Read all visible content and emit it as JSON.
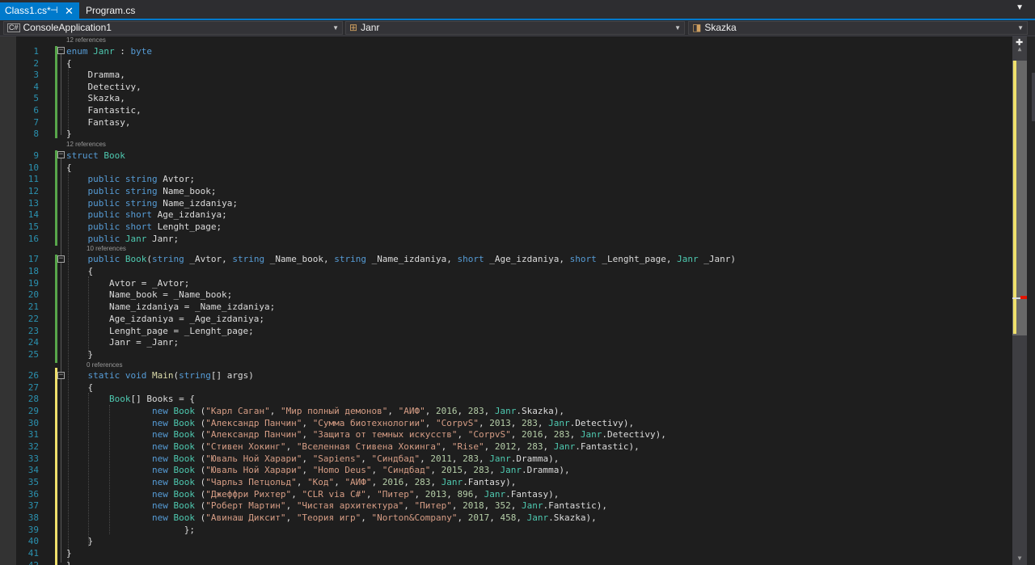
{
  "tabs": [
    {
      "label": "Class1.cs*",
      "pin": "⊣",
      "close": "✕"
    },
    {
      "label": "Program.cs"
    }
  ],
  "tab_dropdown": "▼",
  "navbar": {
    "project": "ConsoleApplication1",
    "project_icon": "C#",
    "type": "Janr",
    "member": "Skazka",
    "dropdown_arrow": "▼",
    "split": "✚"
  },
  "lens": [
    "12 references",
    "12 references",
    "10 references",
    "0 references"
  ],
  "code": [
    {
      "ln": "1",
      "tokens": [
        [
          "k",
          "enum"
        ],
        [
          "",
          ""
        ],
        [
          "t",
          " Janr"
        ],
        [
          "",
          " : "
        ],
        [
          "k",
          "byte"
        ]
      ]
    },
    {
      "ln": "2",
      "tokens": [
        [
          "",
          "{"
        ]
      ]
    },
    {
      "ln": "3",
      "tokens": [
        [
          "",
          "    Dramma,"
        ]
      ]
    },
    {
      "ln": "4",
      "tokens": [
        [
          "",
          "    Detectivy,"
        ]
      ]
    },
    {
      "ln": "5",
      "tokens": [
        [
          "",
          "    Skazka,"
        ]
      ]
    },
    {
      "ln": "6",
      "tokens": [
        [
          "",
          "    Fantastic,"
        ]
      ]
    },
    {
      "ln": "7",
      "tokens": [
        [
          "",
          "    Fantasy,"
        ]
      ]
    },
    {
      "ln": "8",
      "tokens": [
        [
          "",
          "}"
        ]
      ]
    },
    {
      "ln": "9",
      "tokens": [
        [
          "k",
          "struct"
        ],
        [
          "t",
          " Book"
        ]
      ]
    },
    {
      "ln": "10",
      "tokens": [
        [
          "",
          "{"
        ]
      ]
    },
    {
      "ln": "11",
      "tokens": [
        [
          "",
          "    "
        ],
        [
          "k",
          "public"
        ],
        [
          "",
          " "
        ],
        [
          "k",
          "string"
        ],
        [
          "",
          " Avtor;"
        ]
      ]
    },
    {
      "ln": "12",
      "tokens": [
        [
          "",
          "    "
        ],
        [
          "k",
          "public"
        ],
        [
          "",
          " "
        ],
        [
          "k",
          "string"
        ],
        [
          "",
          " Name_book;"
        ]
      ]
    },
    {
      "ln": "13",
      "tokens": [
        [
          "",
          "    "
        ],
        [
          "k",
          "public"
        ],
        [
          "",
          " "
        ],
        [
          "k",
          "string"
        ],
        [
          "",
          " Name_izdaniya;"
        ]
      ]
    },
    {
      "ln": "14",
      "tokens": [
        [
          "",
          "    "
        ],
        [
          "k",
          "public"
        ],
        [
          "",
          " "
        ],
        [
          "k",
          "short"
        ],
        [
          "",
          " Age_izdaniya;"
        ]
      ]
    },
    {
      "ln": "15",
      "tokens": [
        [
          "",
          "    "
        ],
        [
          "k",
          "public"
        ],
        [
          "",
          " "
        ],
        [
          "k",
          "short"
        ],
        [
          "",
          " Lenght_page;"
        ]
      ]
    },
    {
      "ln": "16",
      "tokens": [
        [
          "",
          "    "
        ],
        [
          "k",
          "public"
        ],
        [
          "",
          " "
        ],
        [
          "t",
          "Janr"
        ],
        [
          "",
          " Janr;"
        ]
      ]
    },
    {
      "ln": "17",
      "tokens": [
        [
          "",
          "    "
        ],
        [
          "k",
          "public"
        ],
        [
          "",
          " "
        ],
        [
          "t",
          "Book"
        ],
        [
          "",
          "("
        ],
        [
          "k",
          "string"
        ],
        [
          "",
          " _Avtor, "
        ],
        [
          "k",
          "string"
        ],
        [
          "",
          " _Name_book, "
        ],
        [
          "k",
          "string"
        ],
        [
          "",
          " _Name_izdaniya, "
        ],
        [
          "k",
          "short"
        ],
        [
          "",
          " _Age_izdaniya, "
        ],
        [
          "k",
          "short"
        ],
        [
          "",
          " _Lenght_page, "
        ],
        [
          "t",
          "Janr"
        ],
        [
          "",
          " _Janr)"
        ]
      ]
    },
    {
      "ln": "18",
      "tokens": [
        [
          "",
          "    {"
        ]
      ]
    },
    {
      "ln": "19",
      "tokens": [
        [
          "",
          "        Avtor = _Avtor;"
        ]
      ]
    },
    {
      "ln": "20",
      "tokens": [
        [
          "",
          "        Name_book = _Name_book;"
        ]
      ]
    },
    {
      "ln": "21",
      "tokens": [
        [
          "",
          "        Name_izdaniya = _Name_izdaniya;"
        ]
      ]
    },
    {
      "ln": "22",
      "tokens": [
        [
          "",
          "        Age_izdaniya = _Age_izdaniya;"
        ]
      ]
    },
    {
      "ln": "23",
      "tokens": [
        [
          "",
          "        Lenght_page = _Lenght_page;"
        ]
      ]
    },
    {
      "ln": "24",
      "tokens": [
        [
          "",
          "        Janr = _Janr;"
        ]
      ]
    },
    {
      "ln": "25",
      "tokens": [
        [
          "",
          "    }"
        ]
      ]
    },
    {
      "ln": "26",
      "tokens": [
        [
          "",
          "    "
        ],
        [
          "k",
          "static"
        ],
        [
          "",
          " "
        ],
        [
          "k",
          "void"
        ],
        [
          "",
          " "
        ],
        [
          "m",
          "Main"
        ],
        [
          "",
          "("
        ],
        [
          "k",
          "string"
        ],
        [
          "",
          "[] args)"
        ]
      ]
    },
    {
      "ln": "27",
      "tokens": [
        [
          "",
          "    {"
        ]
      ]
    },
    {
      "ln": "28",
      "tokens": [
        [
          "",
          "        "
        ],
        [
          "t",
          "Book"
        ],
        [
          "",
          "[] Books = {"
        ]
      ]
    },
    {
      "ln": "29",
      "tokens": [
        [
          "",
          "                "
        ],
        [
          "k",
          "new"
        ],
        [
          "",
          " "
        ],
        [
          "t",
          "Book"
        ],
        [
          "",
          " ("
        ],
        [
          "s",
          "\"Карл Саган\""
        ],
        [
          "",
          ", "
        ],
        [
          "s",
          "\"Мир полный демонов\""
        ],
        [
          "",
          ", "
        ],
        [
          "s",
          "\"АИФ\""
        ],
        [
          "",
          ", "
        ],
        [
          "n",
          "2016"
        ],
        [
          "",
          ", "
        ],
        [
          "n",
          "283"
        ],
        [
          "",
          ", "
        ],
        [
          "t",
          "Janr"
        ],
        [
          "",
          ".Skazka),"
        ]
      ]
    },
    {
      "ln": "30",
      "tokens": [
        [
          "",
          "                "
        ],
        [
          "k",
          "new"
        ],
        [
          "",
          " "
        ],
        [
          "t",
          "Book"
        ],
        [
          "",
          " ("
        ],
        [
          "s",
          "\"Александр Панчин\""
        ],
        [
          "",
          ", "
        ],
        [
          "s",
          "\"Сумма биотехнологии\""
        ],
        [
          "",
          ", "
        ],
        [
          "s",
          "\"CorpvS\""
        ],
        [
          "",
          ", "
        ],
        [
          "n",
          "2013"
        ],
        [
          "",
          ", "
        ],
        [
          "n",
          "283"
        ],
        [
          "",
          ", "
        ],
        [
          "t",
          "Janr"
        ],
        [
          "",
          ".Detectivy),"
        ]
      ]
    },
    {
      "ln": "31",
      "tokens": [
        [
          "",
          "                "
        ],
        [
          "k",
          "new"
        ],
        [
          "",
          " "
        ],
        [
          "t",
          "Book"
        ],
        [
          "",
          " ("
        ],
        [
          "s",
          "\"Александр Панчин\""
        ],
        [
          "",
          ", "
        ],
        [
          "s",
          "\"Защита от темных искусств\""
        ],
        [
          "",
          ", "
        ],
        [
          "s",
          "\"CorpvS\""
        ],
        [
          "",
          ", "
        ],
        [
          "n",
          "2016"
        ],
        [
          "",
          ", "
        ],
        [
          "n",
          "283"
        ],
        [
          "",
          ", "
        ],
        [
          "t",
          "Janr"
        ],
        [
          "",
          ".Detectivy),"
        ]
      ]
    },
    {
      "ln": "32",
      "tokens": [
        [
          "",
          "                "
        ],
        [
          "k",
          "new"
        ],
        [
          "",
          " "
        ],
        [
          "t",
          "Book"
        ],
        [
          "",
          " ("
        ],
        [
          "s",
          "\"Стивен Хокинг\""
        ],
        [
          "",
          ", "
        ],
        [
          "s",
          "\"Вселенная Стивена Хокинга\""
        ],
        [
          "",
          ", "
        ],
        [
          "s",
          "\"Rise\""
        ],
        [
          "",
          ", "
        ],
        [
          "n",
          "2012"
        ],
        [
          "",
          ", "
        ],
        [
          "n",
          "283"
        ],
        [
          "",
          ", "
        ],
        [
          "t",
          "Janr"
        ],
        [
          "",
          ".Fantastic),"
        ]
      ]
    },
    {
      "ln": "33",
      "tokens": [
        [
          "",
          "                "
        ],
        [
          "k",
          "new"
        ],
        [
          "",
          " "
        ],
        [
          "t",
          "Book"
        ],
        [
          "",
          " ("
        ],
        [
          "s",
          "\"Юваль Ной Харари\""
        ],
        [
          "",
          ", "
        ],
        [
          "s",
          "\"Sapiens\""
        ],
        [
          "",
          ", "
        ],
        [
          "s",
          "\"Синдбад\""
        ],
        [
          "",
          ", "
        ],
        [
          "n",
          "2011"
        ],
        [
          "",
          ", "
        ],
        [
          "n",
          "283"
        ],
        [
          "",
          ", "
        ],
        [
          "t",
          "Janr"
        ],
        [
          "",
          ".Dramma),"
        ]
      ]
    },
    {
      "ln": "34",
      "tokens": [
        [
          "",
          "                "
        ],
        [
          "k",
          "new"
        ],
        [
          "",
          " "
        ],
        [
          "t",
          "Book"
        ],
        [
          "",
          " ("
        ],
        [
          "s",
          "\"Юваль Ной Харари\""
        ],
        [
          "",
          ", "
        ],
        [
          "s",
          "\"Homo Deus\""
        ],
        [
          "",
          ", "
        ],
        [
          "s",
          "\"Синдбад\""
        ],
        [
          "",
          ", "
        ],
        [
          "n",
          "2015"
        ],
        [
          "",
          ", "
        ],
        [
          "n",
          "283"
        ],
        [
          "",
          ", "
        ],
        [
          "t",
          "Janr"
        ],
        [
          "",
          ".Dramma),"
        ]
      ]
    },
    {
      "ln": "35",
      "tokens": [
        [
          "",
          "                "
        ],
        [
          "k",
          "new"
        ],
        [
          "",
          " "
        ],
        [
          "t",
          "Book"
        ],
        [
          "",
          " ("
        ],
        [
          "s",
          "\"Чарльз Петцольд\""
        ],
        [
          "",
          ", "
        ],
        [
          "s",
          "\"Код\""
        ],
        [
          "",
          ", "
        ],
        [
          "s",
          "\"АИФ\""
        ],
        [
          "",
          ", "
        ],
        [
          "n",
          "2016"
        ],
        [
          "",
          ", "
        ],
        [
          "n",
          "283"
        ],
        [
          "",
          ", "
        ],
        [
          "t",
          "Janr"
        ],
        [
          "",
          ".Fantasy),"
        ]
      ]
    },
    {
      "ln": "36",
      "tokens": [
        [
          "",
          "                "
        ],
        [
          "k",
          "new"
        ],
        [
          "",
          " "
        ],
        [
          "t",
          "Book"
        ],
        [
          "",
          " ("
        ],
        [
          "s",
          "\"Джеффри Рихтер\""
        ],
        [
          "",
          ", "
        ],
        [
          "s",
          "\"CLR via C#\""
        ],
        [
          "",
          ", "
        ],
        [
          "s",
          "\"Питер\""
        ],
        [
          "",
          ", "
        ],
        [
          "n",
          "2013"
        ],
        [
          "",
          ", "
        ],
        [
          "n",
          "896"
        ],
        [
          "",
          ", "
        ],
        [
          "t",
          "Janr"
        ],
        [
          "",
          ".Fantasy),"
        ]
      ]
    },
    {
      "ln": "37",
      "tokens": [
        [
          "",
          "                "
        ],
        [
          "k",
          "new"
        ],
        [
          "",
          " "
        ],
        [
          "t",
          "Book"
        ],
        [
          "",
          " ("
        ],
        [
          "s",
          "\"Роберт Мартин\""
        ],
        [
          "",
          ", "
        ],
        [
          "s",
          "\"Чистая архитектура\""
        ],
        [
          "",
          ", "
        ],
        [
          "s",
          "\"Питер\""
        ],
        [
          "",
          ", "
        ],
        [
          "n",
          "2018"
        ],
        [
          "",
          ", "
        ],
        [
          "n",
          "352"
        ],
        [
          "",
          ", "
        ],
        [
          "t",
          "Janr"
        ],
        [
          "",
          ".Fantastic),"
        ]
      ]
    },
    {
      "ln": "38",
      "tokens": [
        [
          "",
          "                "
        ],
        [
          "k",
          "new"
        ],
        [
          "",
          " "
        ],
        [
          "t",
          "Book"
        ],
        [
          "",
          " ("
        ],
        [
          "s",
          "\"Авинаш Диксит\""
        ],
        [
          "",
          ", "
        ],
        [
          "s",
          "\"Теория игр\""
        ],
        [
          "",
          ", "
        ],
        [
          "s",
          "\"Norton&Company\""
        ],
        [
          "",
          ", "
        ],
        [
          "n",
          "2017"
        ],
        [
          "",
          ", "
        ],
        [
          "n",
          "458"
        ],
        [
          "",
          ", "
        ],
        [
          "t",
          "Janr"
        ],
        [
          "",
          ".Skazka),"
        ]
      ]
    },
    {
      "ln": "39",
      "tokens": [
        [
          "",
          "                      };"
        ]
      ]
    },
    {
      "ln": "40",
      "tokens": [
        [
          "",
          "    }"
        ]
      ]
    },
    {
      "ln": "41",
      "tokens": [
        [
          "",
          "}"
        ]
      ]
    },
    {
      "ln": "42",
      "tokens": [
        [
          "",
          "}"
        ]
      ]
    }
  ],
  "colors": {
    "keyword": "#569cd6",
    "type": "#4ec9b0",
    "string": "#d69d85",
    "number": "#b5cea8",
    "method": "#dcdcaa",
    "line_number": "#2b91af",
    "tab_active": "#007acc"
  }
}
